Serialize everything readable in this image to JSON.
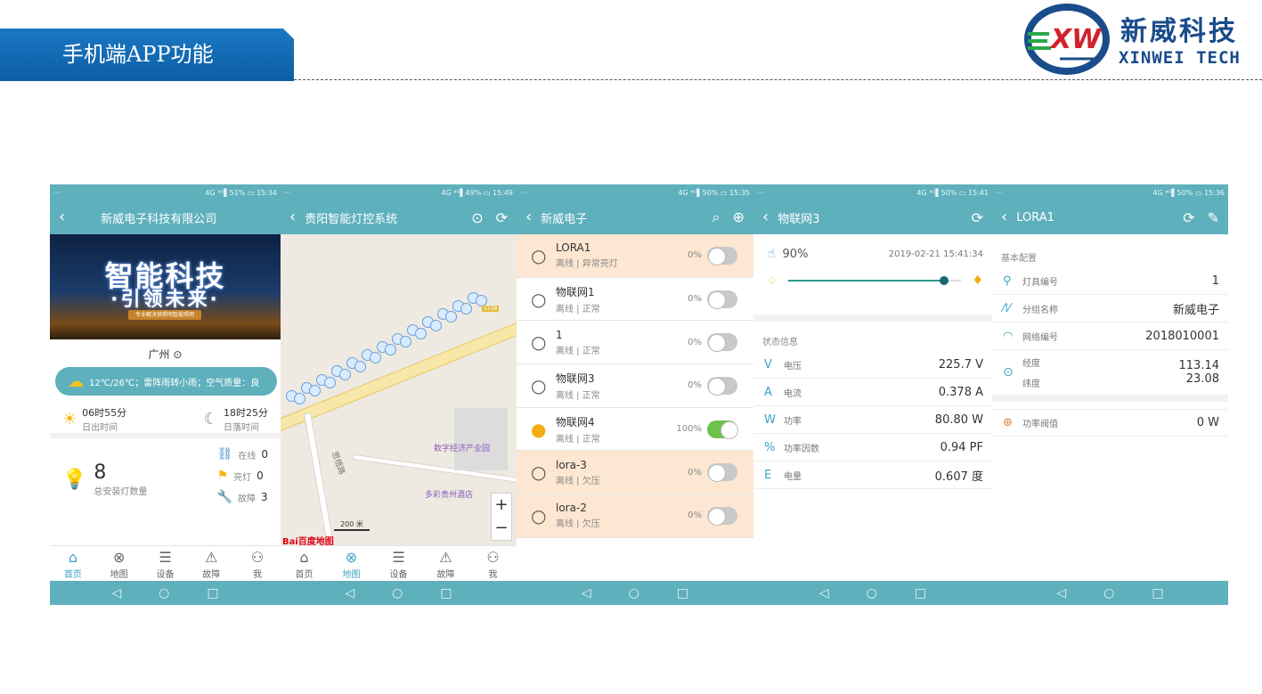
{
  "header": {
    "title": "手机端APP功能"
  },
  "logo": {
    "cn": "新威科技",
    "en": "XINWEI TECH",
    "mark": "XW"
  },
  "phones": [
    {
      "status": {
        "left": "···",
        "right": "4G ⁴ᴳ▌51% ▭ 15:34"
      },
      "nav": {
        "title": "新威电子科技有限公司",
        "back": "‹"
      },
      "banner": {
        "line1": "智能科技",
        "line2": "·引领未来·",
        "ribbon": "专业解决供照明智能照明"
      },
      "city": "广州",
      "weather": "12℃/26℃；雷阵雨转小雨；空气质量：良",
      "sunrise": {
        "time": "06时55分",
        "label": "日出时间"
      },
      "sunset": {
        "time": "18时25分",
        "label": "日落时间"
      },
      "total": {
        "value": "8",
        "label": "总安装灯数量"
      },
      "stats": [
        {
          "label": "在线",
          "value": "0"
        },
        {
          "label": "亮灯",
          "value": "0"
        },
        {
          "label": "故障",
          "value": "3"
        }
      ],
      "tabs": [
        "首页",
        "地图",
        "设备",
        "故障",
        "我"
      ],
      "active_tab": 0
    },
    {
      "status": {
        "left": "···",
        "right": "4G ⁴ᴳ▌49% ▭ 15:49"
      },
      "nav": {
        "title": "贵阳智能灯控系统",
        "back": "‹"
      },
      "map": {
        "poi1": "数字经济产业园",
        "poi2": "多彩贵州酒店",
        "road": "思梧路",
        "scale": "200 米",
        "brand": "Bai百度地图",
        "route": "S108"
      },
      "tabs": [
        "首页",
        "地图",
        "设备",
        "故障",
        "我"
      ],
      "active_tab": 1
    },
    {
      "status": {
        "left": "···",
        "right": "4G ⁴ᴳ▌50% ▭ 15:35"
      },
      "nav": {
        "title": "新威电子",
        "back": "‹"
      },
      "items": [
        {
          "name": "LORA1",
          "status": "离线 | 异常亮灯",
          "pct": "0%",
          "on": false,
          "warn": true
        },
        {
          "name": "物联网1",
          "status": "离线 | 正常",
          "pct": "0%",
          "on": false,
          "warn": false
        },
        {
          "name": "1",
          "status": "离线 | 正常",
          "pct": "0%",
          "on": false,
          "warn": false
        },
        {
          "name": "物联网3",
          "status": "离线 | 正常",
          "pct": "0%",
          "on": false,
          "warn": false
        },
        {
          "name": "物联网4",
          "status": "离线 | 正常",
          "pct": "100%",
          "on": true,
          "warn": false
        },
        {
          "name": "lora-3",
          "status": "离线 | 欠压",
          "pct": "0%",
          "on": false,
          "warn": true
        },
        {
          "name": "lora-2",
          "status": "离线 | 欠压",
          "pct": "0%",
          "on": false,
          "warn": true
        }
      ]
    },
    {
      "status": {
        "left": "···",
        "right": "4G ⁴ᴳ▌50% ▭ 15:41"
      },
      "nav": {
        "title": "物联网3",
        "back": "‹"
      },
      "brightness": {
        "value": "90%",
        "time": "2019-02-21 15:41:34",
        "level": 0.9
      },
      "section": "状态信息",
      "rows": [
        {
          "icon": "V",
          "label": "电压",
          "value": "225.7 V"
        },
        {
          "icon": "A",
          "label": "电流",
          "value": "0.378 A"
        },
        {
          "icon": "W",
          "label": "功率",
          "value": "80.80 W"
        },
        {
          "icon": "%",
          "label": "功率因数",
          "value": "0.94 PF"
        },
        {
          "icon": "E",
          "label": "电量",
          "value": "0.607 度"
        }
      ]
    },
    {
      "status": {
        "left": "···",
        "right": "4G ⁴ᴳ▌50% ▭ 15:36"
      },
      "nav": {
        "title": "LORA1",
        "back": "‹"
      },
      "section": "基本配置",
      "rows": [
        {
          "label": "灯具编号",
          "value": "1"
        },
        {
          "label": "分组名称",
          "value": "新威电子"
        },
        {
          "label": "网络编号",
          "value": "2018010001"
        }
      ],
      "geo": {
        "lng_label": "经度",
        "lng": "113.14",
        "lat_label": "纬度",
        "lat": "23.08"
      },
      "threshold": {
        "label": "功率阀值",
        "value": "0 W"
      }
    }
  ],
  "sysnav": [
    "◁",
    "○",
    "□"
  ],
  "colors": {
    "teal": "#5fb0bd",
    "blue": "#0c5ea6",
    "warn_row": "#fde7d2",
    "on_toggle": "#6cc24a"
  }
}
